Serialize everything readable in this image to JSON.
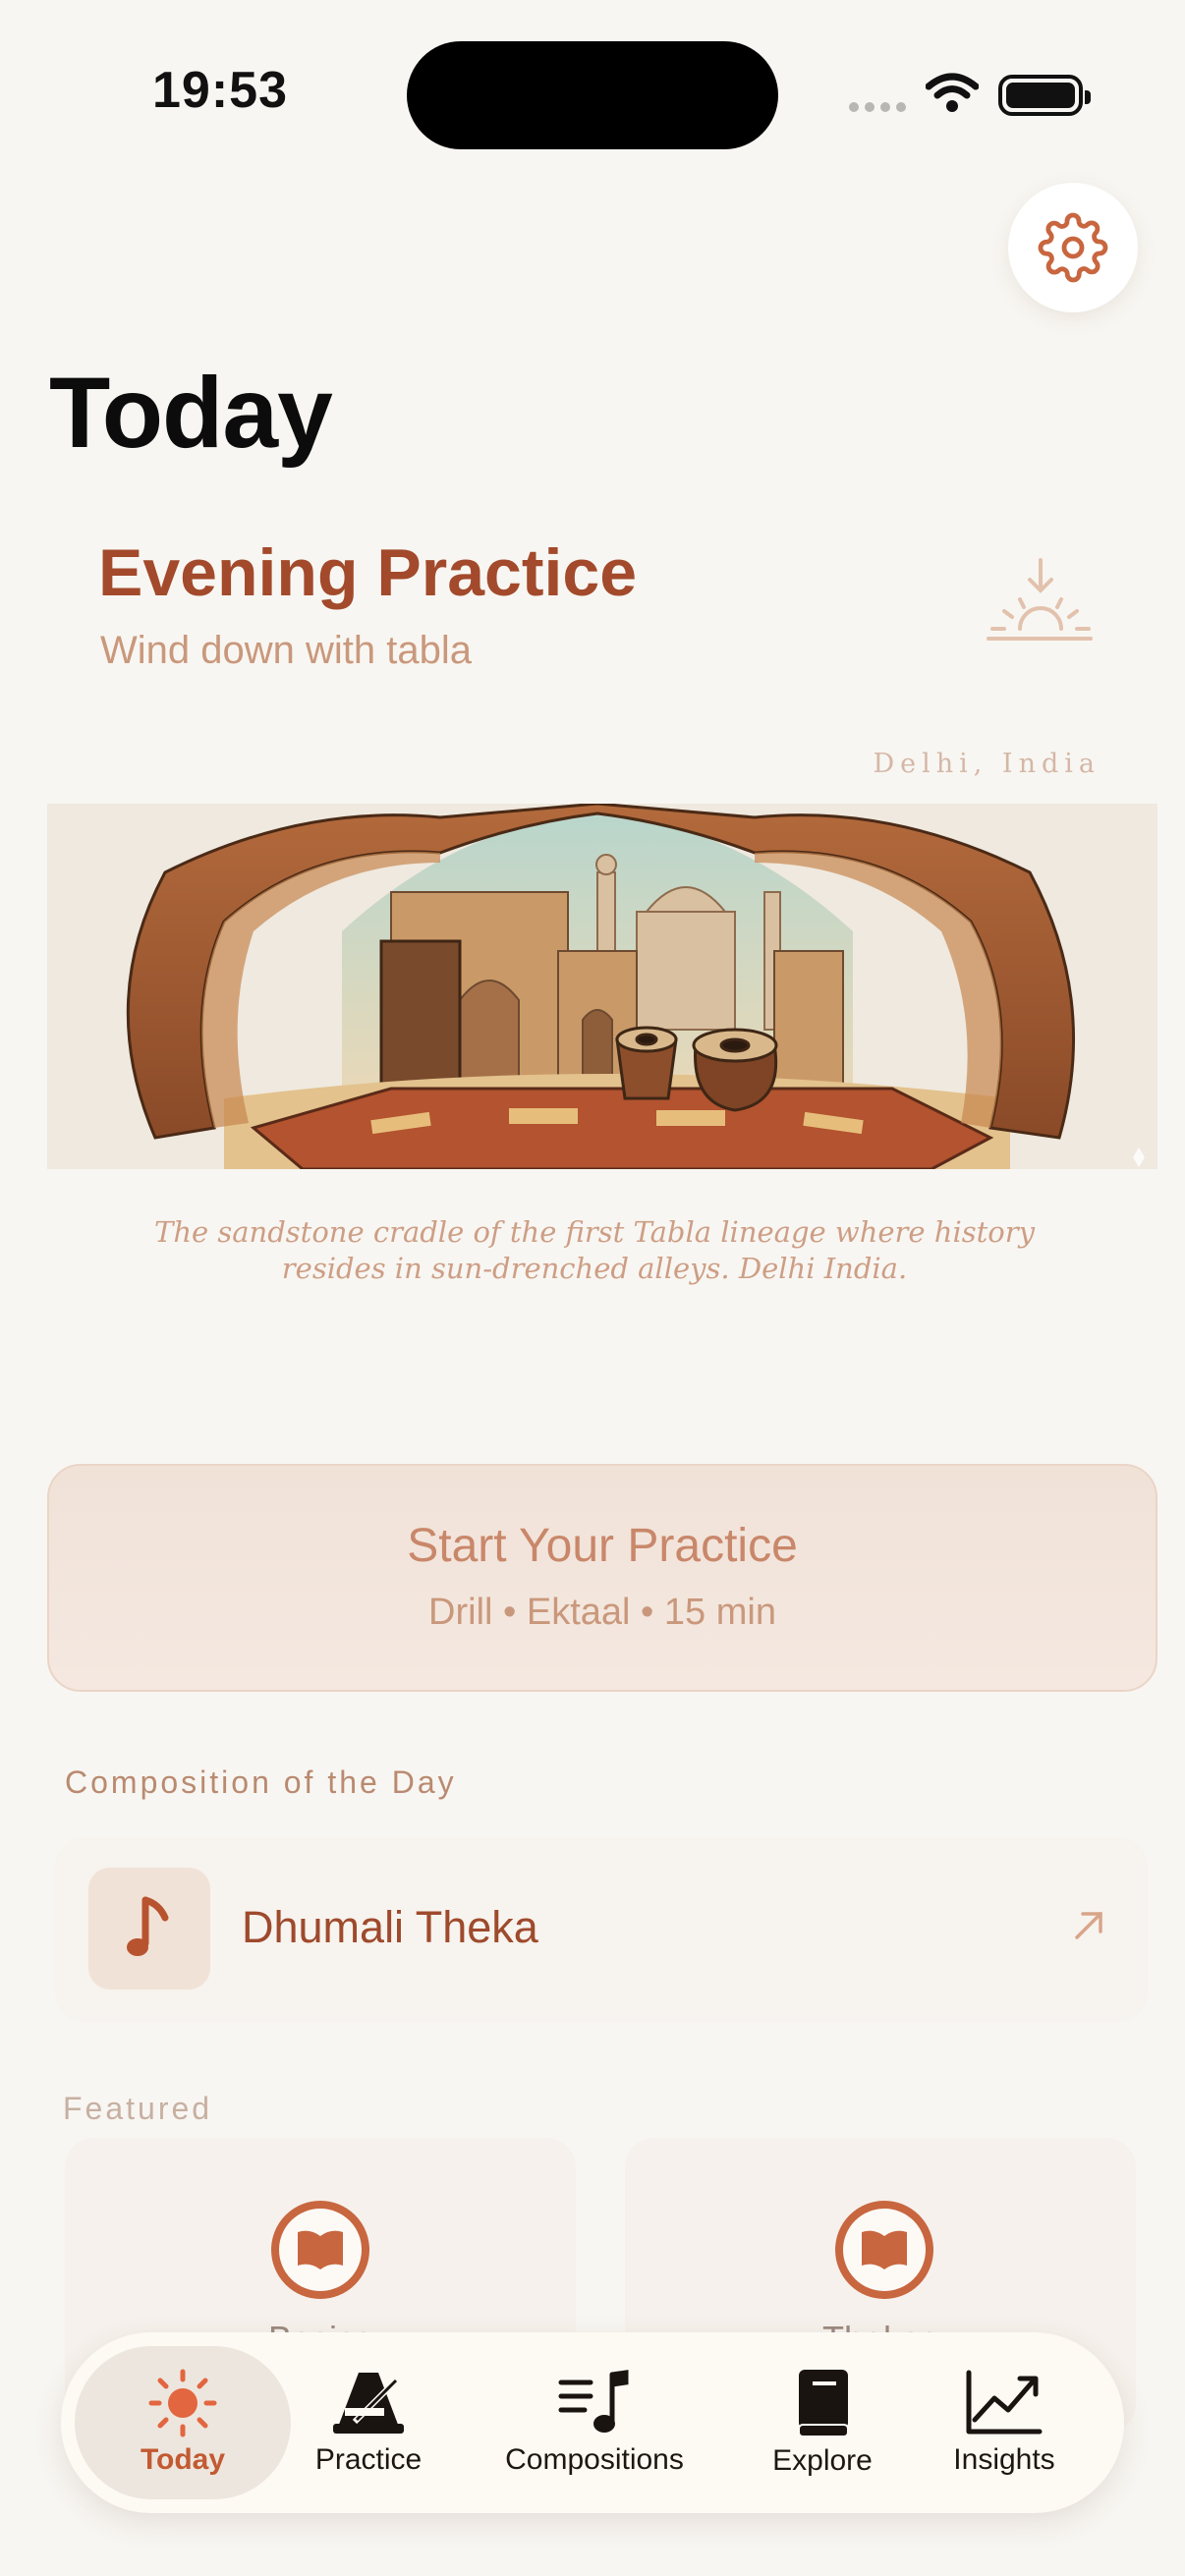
{
  "status_bar": {
    "time": "19:53"
  },
  "header": {
    "title": "Today"
  },
  "session": {
    "title": "Evening Practice",
    "subtitle": "Wind down with tabla"
  },
  "hero": {
    "location": "Delhi, India",
    "caption": "The sandstone cradle of the first Tabla lineage where history resides in sun-drenched alleys. Delhi India."
  },
  "start_practice": {
    "title": "Start Your Practice",
    "meta": "Drill • Ektaal • 15 min"
  },
  "composition_of_day": {
    "heading": "Composition of the Day",
    "name": "Dhumali Theka"
  },
  "featured": {
    "heading": "Featured",
    "items": [
      {
        "label": "Basics"
      },
      {
        "label": "Thekas"
      }
    ]
  },
  "tabs": [
    {
      "label": "Today",
      "icon": "sun-icon",
      "active": true
    },
    {
      "label": "Practice",
      "icon": "metronome-icon"
    },
    {
      "label": "Compositions",
      "icon": "music-list-icon"
    },
    {
      "label": "Explore",
      "icon": "book-icon"
    },
    {
      "label": "Insights",
      "icon": "chart-icon"
    }
  ],
  "colors": {
    "accent": "#c25a32",
    "title_brown": "#a24a2b",
    "background": "#f8f6f2"
  }
}
